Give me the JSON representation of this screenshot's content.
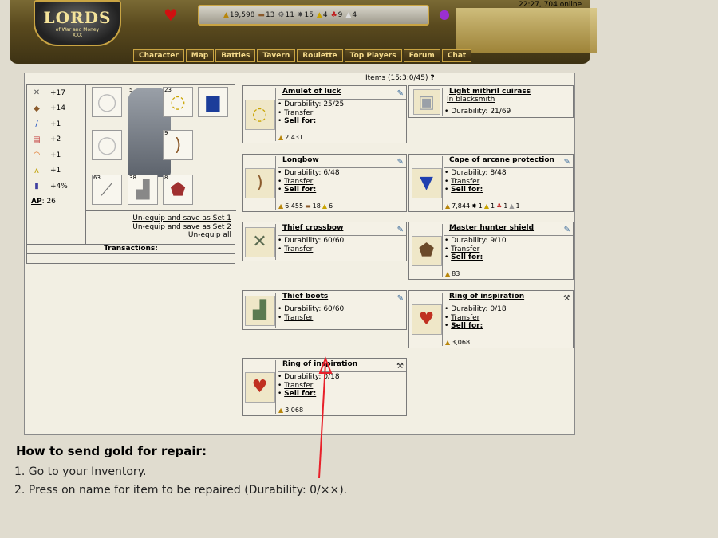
{
  "header": {
    "logo_title": "LORDS",
    "logo_subtitle": "of War and Money",
    "logo_mark": "XXX",
    "clock": "22:27, 704 online",
    "resources": [
      {
        "icon": "gold-icon",
        "value": "19,598"
      },
      {
        "icon": "wood-icon",
        "value": "13"
      },
      {
        "icon": "iron-icon",
        "value": "11"
      },
      {
        "icon": "stone-icon",
        "value": "15"
      },
      {
        "icon": "sulfur-icon",
        "value": "4"
      },
      {
        "icon": "gem-icon",
        "value": "9"
      },
      {
        "icon": "crystal-icon",
        "value": "4"
      }
    ],
    "nav": [
      "Character",
      "Map",
      "Battles",
      "Tavern",
      "Roulette",
      "Top Players",
      "Forum",
      "Chat"
    ]
  },
  "equipment": {
    "stats": [
      {
        "icon": "attack-icon",
        "value": "+17"
      },
      {
        "icon": "defense-icon",
        "value": "+14"
      },
      {
        "icon": "magic-icon",
        "value": "+1"
      },
      {
        "icon": "knowledge-icon",
        "value": "+2"
      },
      {
        "icon": "luck-icon",
        "value": "+1"
      },
      {
        "icon": "morale-icon",
        "value": "+1"
      },
      {
        "icon": "potion-icon",
        "value": "+4%"
      }
    ],
    "ap_label": "AP",
    "ap_value": ": 26",
    "slot_counts": {
      "helmet": "5",
      "amulet": "23",
      "bow": "9",
      "sword": "63",
      "boots": "38",
      "shield": "8"
    },
    "links": [
      "Un-equip and save as Set 1",
      "Un-equip and save as Set 2",
      "Un-equip all"
    ],
    "transactions_label": "Transactions:"
  },
  "inventory": {
    "title": "Items (15:3:0/45)",
    "help": "?",
    "items": [
      {
        "name": "Amulet of luck",
        "details": [
          {
            "text": "Durability: 25/25"
          },
          {
            "text": "Transfer",
            "link": true
          },
          {
            "text": "Sell for:",
            "link": true,
            "bold": true
          }
        ],
        "price": [
          "2,431"
        ]
      },
      {
        "name": "Light mithril cuirass",
        "sub": "In blacksmith",
        "details": [
          {
            "text": "Durability: 21/69"
          }
        ],
        "price": []
      },
      {
        "name": "Longbow",
        "details": [
          {
            "text": "Durability: 6/48"
          },
          {
            "text": "Transfer",
            "link": true
          },
          {
            "text": "Sell for:",
            "link": true,
            "bold": true
          }
        ],
        "price": [
          "6,455",
          "18",
          "6"
        ]
      },
      {
        "name": "Cape of arcane protection",
        "details": [
          {
            "text": "Durability: 8/48"
          },
          {
            "text": "Transfer",
            "link": true
          },
          {
            "text": "Sell for:",
            "link": true,
            "bold": true
          }
        ],
        "price": [
          "7,844",
          "1",
          "1",
          "1",
          "1"
        ]
      },
      {
        "name": "Thief crossbow",
        "details": [
          {
            "text": "Durability: 60/60"
          },
          {
            "text": "Transfer",
            "link": true
          }
        ],
        "price": []
      },
      {
        "name": "Master hunter shield",
        "details": [
          {
            "text": "Durability: 9/10"
          },
          {
            "text": "Transfer",
            "link": true
          },
          {
            "text": "Sell for:",
            "link": true,
            "bold": true
          }
        ],
        "price": [
          "83"
        ]
      },
      {
        "name": "Thief boots",
        "details": [
          {
            "text": "Durability: 60/60"
          },
          {
            "text": "Transfer",
            "link": true
          }
        ],
        "price": []
      },
      {
        "name": "Ring of inspiration",
        "details": [
          {
            "text": "Durability: 0/18"
          },
          {
            "text": "Transfer",
            "link": true
          },
          {
            "text": "Sell for:",
            "link": true,
            "bold": true
          }
        ],
        "price": [
          "3,068"
        ]
      },
      {
        "name": "Ring of inspiration",
        "details": [
          {
            "text": "Durability: 0/18"
          },
          {
            "text": "Transfer",
            "link": true
          },
          {
            "text": "Sell for:",
            "link": true,
            "bold": true
          }
        ],
        "price": [
          "3,068"
        ]
      }
    ]
  },
  "instructions": {
    "title": "How to send gold for repair:",
    "steps": [
      "1. Go to your Inventory.",
      "2. Press on name for item to be repaired (Durability: 0/××)."
    ]
  },
  "colors": {
    "arrow": "#e8202a",
    "nav_text": "#f3d98a",
    "panel_bg": "#f2efe3"
  }
}
